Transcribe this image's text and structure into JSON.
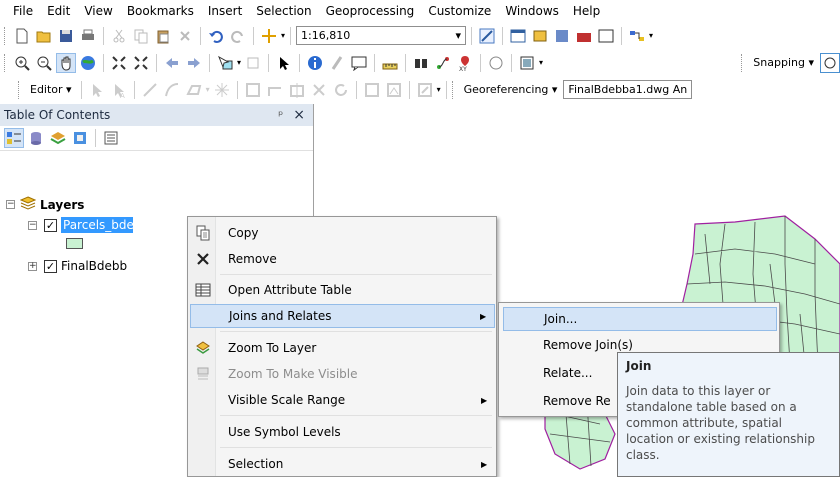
{
  "menubar": [
    "File",
    "Edit",
    "View",
    "Bookmarks",
    "Insert",
    "Selection",
    "Geoprocessing",
    "Customize",
    "Windows",
    "Help"
  ],
  "toolbar1": {
    "scale_value": "1:16,810"
  },
  "toolbar2": {
    "snapping_label": "Snapping ▾"
  },
  "toolbar3": {
    "editor_label": "Editor ▾",
    "georef_label": "Georeferencing ▾",
    "georef_layer": "FinalBdebba1.dwg An"
  },
  "toc": {
    "title": "Table Of Contents",
    "pin": "&#x1F4CC;",
    "close": "×",
    "layers_label": "Layers",
    "layer1": "Parcels_bde",
    "layer2": "FinalBdebb"
  },
  "context_menu": [
    {
      "label": "Copy",
      "icon": "copy-icon",
      "enabled": true
    },
    {
      "label": "Remove",
      "icon": "remove-icon",
      "enabled": true
    },
    {
      "label": "Open Attribute Table",
      "icon": "table-icon",
      "enabled": true
    },
    {
      "label": "Joins and Relates",
      "icon": "",
      "enabled": true,
      "submenu": true,
      "highlighted": true
    },
    {
      "label": "Zoom To Layer",
      "icon": "zoom-layer-icon",
      "enabled": true
    },
    {
      "label": "Zoom To Make Visible",
      "icon": "zoom-visible-icon",
      "enabled": false
    },
    {
      "label": "Visible Scale Range",
      "icon": "",
      "enabled": true,
      "submenu": true
    },
    {
      "label": "Use Symbol Levels",
      "icon": "",
      "enabled": true
    },
    {
      "label": "Selection",
      "icon": "",
      "enabled": true,
      "submenu": true
    }
  ],
  "submenu": [
    "Join...",
    "Remove Join(s)",
    "Relate...",
    "Remove Re"
  ],
  "tooltip": {
    "title": "Join",
    "body": "Join data to this layer or standalone table based on a common attribute, spatial location or existing relationship class."
  },
  "colors": {
    "parcel_fill": "#c9f2d2",
    "parcel_stroke": "#4a4a4a",
    "boundary": "#a020a0",
    "highlight": "#d4e4f7"
  }
}
